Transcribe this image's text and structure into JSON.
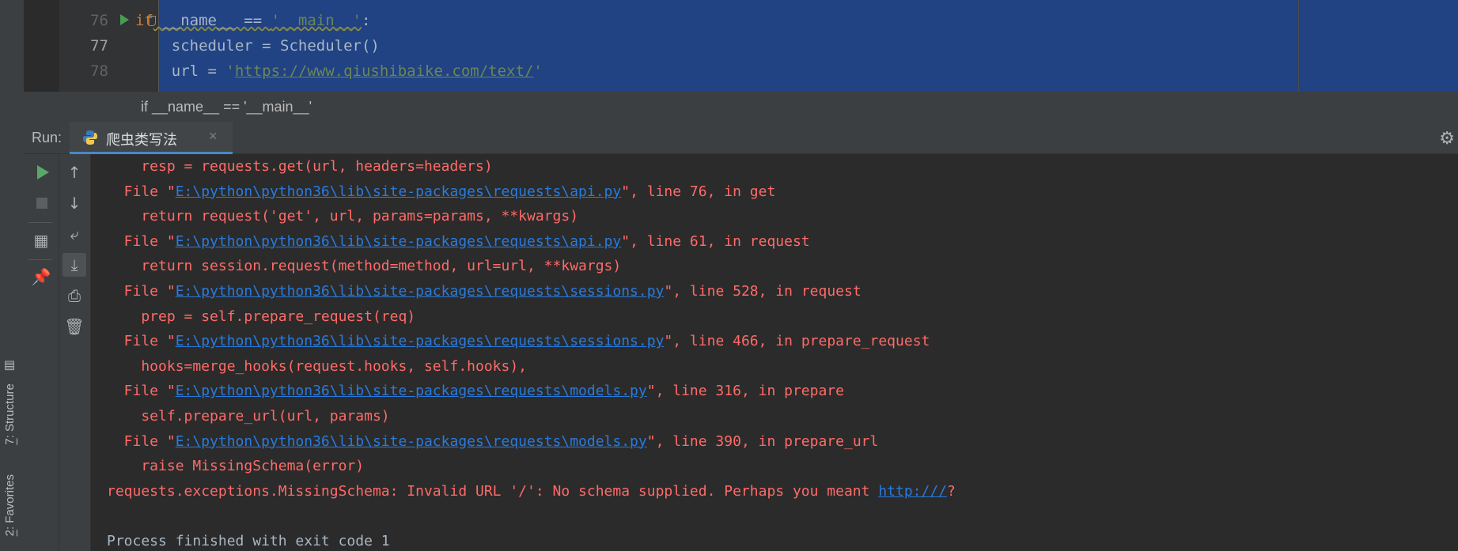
{
  "side_tabs": {
    "structure": {
      "num": "7",
      "label": ": Structure"
    },
    "favorites": {
      "num": "2",
      "label": ": Favorites"
    }
  },
  "editor": {
    "lines": [
      {
        "number": "76",
        "kw": "if",
        "pre": " __name__ == ",
        "str": "'__main__'",
        "post": ":"
      },
      {
        "number": "77",
        "text": "    scheduler = Scheduler()"
      },
      {
        "number": "78",
        "pre": "    url = ",
        "q1": "'",
        "url": "https://www.qiushibaike.com/text/",
        "q2": "'"
      }
    ]
  },
  "breadcrumb": {
    "text": "if __name__ == '__main__'"
  },
  "run_panel": {
    "label": "Run:",
    "tab_title": "爬虫类写法",
    "close_glyph": "×",
    "settings_icon": "gear-icon"
  },
  "console": {
    "lines": [
      {
        "type": "code",
        "text": "    resp = requests.get(url, headers=headers)"
      },
      {
        "type": "file",
        "pre": "  File \"",
        "link": "E:\\python\\python36\\lib\\site-packages\\requests\\api.py",
        "post": "\", line 76, in get"
      },
      {
        "type": "code",
        "text": "    return request('get', url, params=params, **kwargs)"
      },
      {
        "type": "file",
        "pre": "  File \"",
        "link": "E:\\python\\python36\\lib\\site-packages\\requests\\api.py",
        "post": "\", line 61, in request"
      },
      {
        "type": "code",
        "text": "    return session.request(method=method, url=url, **kwargs)"
      },
      {
        "type": "file",
        "pre": "  File \"",
        "link": "E:\\python\\python36\\lib\\site-packages\\requests\\sessions.py",
        "post": "\", line 528, in request"
      },
      {
        "type": "code",
        "text": "    prep = self.prepare_request(req)"
      },
      {
        "type": "file",
        "pre": "  File \"",
        "link": "E:\\python\\python36\\lib\\site-packages\\requests\\sessions.py",
        "post": "\", line 466, in prepare_request"
      },
      {
        "type": "code",
        "text": "    hooks=merge_hooks(request.hooks, self.hooks),"
      },
      {
        "type": "file",
        "pre": "  File \"",
        "link": "E:\\python\\python36\\lib\\site-packages\\requests\\models.py",
        "post": "\", line 316, in prepare"
      },
      {
        "type": "code",
        "text": "    self.prepare_url(url, params)"
      },
      {
        "type": "file",
        "pre": "  File \"",
        "link": "E:\\python\\python36\\lib\\site-packages\\requests\\models.py",
        "post": "\", line 390, in prepare_url"
      },
      {
        "type": "code",
        "text": "    raise MissingSchema(error)"
      },
      {
        "type": "error",
        "pre": "requests.exceptions.MissingSchema: Invalid URL '/': No schema supplied. Perhaps you meant ",
        "link": "http:///",
        "post": "?"
      },
      {
        "type": "blank",
        "text": ""
      },
      {
        "type": "normal",
        "text": "Process finished with exit code 1"
      }
    ]
  }
}
